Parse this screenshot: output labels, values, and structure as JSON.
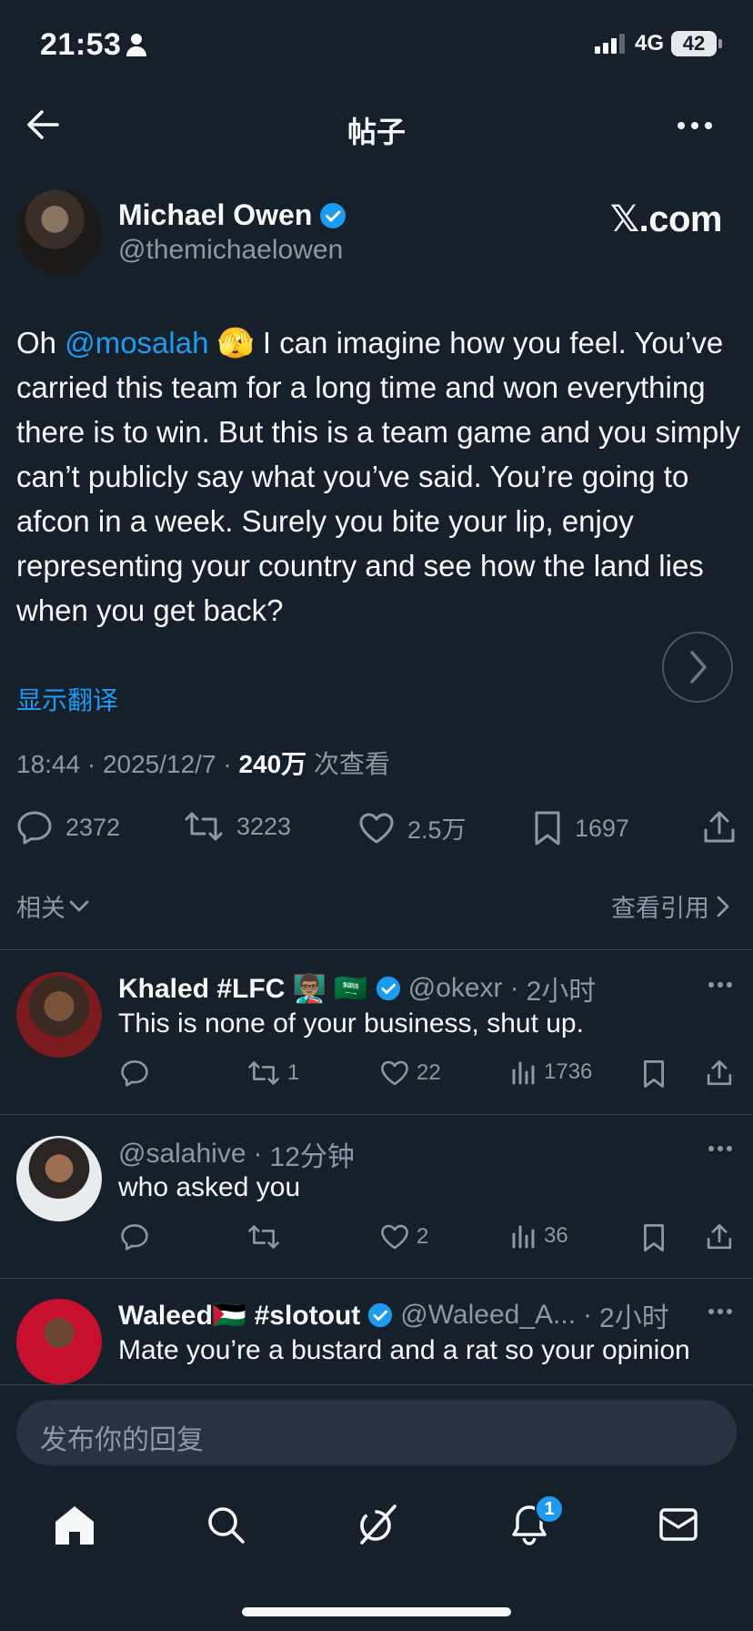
{
  "status_bar": {
    "time": "21:53",
    "network": "4G",
    "battery": "42"
  },
  "header": {
    "title": "帖子"
  },
  "post": {
    "author_name": "Michael Owen",
    "author_handle": "@themichaelowen",
    "brand": "𝕏.com",
    "text_parts": [
      "Oh ",
      "@mosalah",
      " 🫣 I can imagine how you feel. You’ve carried this team for a long time and won everything there is to win. But this is a team game and you simply can’t publicly say what you’ve said. You’re going to afcon in a week. Surely you bite your lip, enjoy representing your country and see how the land lies when you get back?"
    ],
    "translate_label": "显示翻译",
    "time": "18:44",
    "date": "2025/12/7",
    "views_count": "240万",
    "views_label": "次查看",
    "actions": {
      "replies": "2372",
      "reposts": "3223",
      "likes": "2.5万",
      "bookmarks": "1697"
    }
  },
  "related": {
    "label": "相关",
    "quotes_label": "查看引用"
  },
  "replies": [
    {
      "name": "Khaled #LFC 👨🏽‍🏫 🇸🇦",
      "handle": "@okexr",
      "time": "2小时",
      "text": "This is none of your business, shut up.",
      "replies": "",
      "reposts": "1",
      "likes": "22",
      "views": "1736"
    },
    {
      "name": "",
      "handle": "@salahive",
      "time": "12分钟",
      "text": "who asked you",
      "replies": "",
      "reposts": "",
      "likes": "2",
      "views": "36"
    },
    {
      "name": "Waleed🇵🇸 #slotout",
      "handle": "@Waleed_A...",
      "time": "2小时",
      "text": "Mate you’re a bustard and a rat so your opinion"
    }
  ],
  "composer": {
    "placeholder": "发布你的回复"
  },
  "tabbar": {
    "notification_badge": "1"
  },
  "colors": {
    "background": "#15202b",
    "accent": "#1d9bf0",
    "muted": "#8b98a5",
    "divider": "#38444d"
  }
}
